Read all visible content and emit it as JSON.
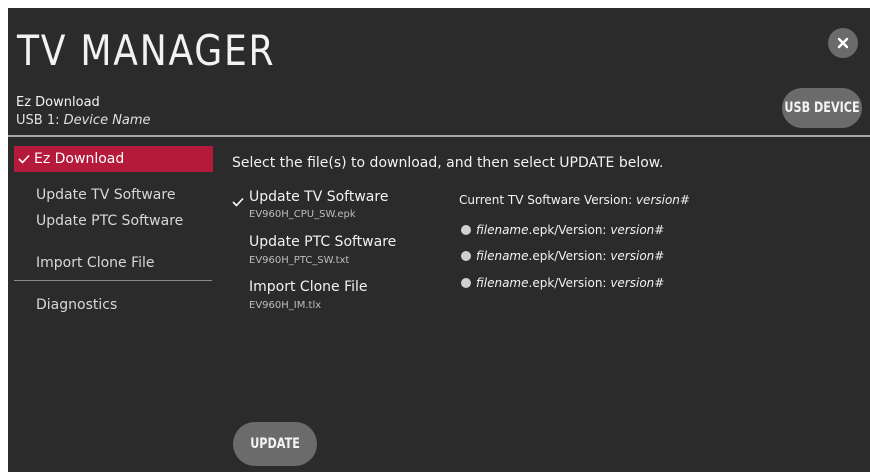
{
  "app": {
    "title": "TV MANAGER"
  },
  "source": {
    "label": "Ez Download",
    "device_prefix": "USB 1:",
    "device_name": "Device Name"
  },
  "buttons": {
    "usb_device": "USB DEVICE",
    "update": "UPDATE"
  },
  "menu": {
    "selected": "Ez Download",
    "items": [
      "Update TV Software",
      "Update PTC Software",
      "Import Clone File",
      "Diagnostics"
    ]
  },
  "main": {
    "instruction": "Select the file(s) to download, and then select UPDATE below.",
    "files": [
      {
        "title": "Update TV Software",
        "filename": "EV960H_CPU_SW.epk",
        "checked": true
      },
      {
        "title": "Update PTC Software",
        "filename": "EV960H_PTC_SW.txt",
        "checked": false
      },
      {
        "title": "Import Clone File",
        "filename": "EV960H_IM.tlx",
        "checked": false
      }
    ],
    "current_version_label": "Current TV Software Version:",
    "current_version_value": "version#",
    "options": [
      {
        "filename": "filename",
        "ext_label": ".epk/Version:",
        "version": "version#"
      },
      {
        "filename": "filename",
        "ext_label": ".epk/Version:",
        "version": "version#"
      },
      {
        "filename": "filename",
        "ext_label": ".epk/Version:",
        "version": "version#"
      }
    ]
  },
  "icons": {
    "close": "close-icon",
    "check": "check-icon",
    "radio": "radio-icon"
  },
  "colors": {
    "background": "#2b2b2b",
    "accent": "#b51a3a",
    "button": "#6b6b6b"
  }
}
